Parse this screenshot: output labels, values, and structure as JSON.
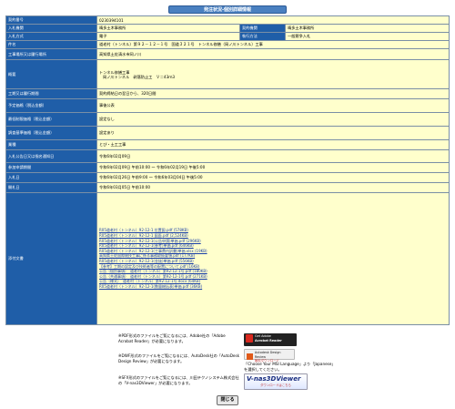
{
  "page_title": "発注状況-個別詳細情報",
  "rows": {
    "contract_no": {
      "label": "契約番号",
      "value": "0230394101"
    },
    "bureau": {
      "label": "入札機関",
      "value": "晴多土木事務所"
    },
    "contract_bureau": {
      "label": "契約機関",
      "value": "晴多土木事務所"
    },
    "bid_type": {
      "label": "入札方式",
      "value": "電子"
    },
    "exec_method": {
      "label": "執行方法",
      "value": "一般競争入札"
    },
    "work_name": {
      "label": "件名",
      "value": "道老村（トンネル）第９２－１２－１号　国道３２１号　トンネル修繕（岡ノ川トンネル）工事"
    },
    "location": {
      "label": "工事場所又は履行場所",
      "value": "高知県土佐清水市岡ノ川"
    },
    "summary": {
      "label": "概要",
      "line1": "トンネル修繕工事",
      "line2": "岡ノ川トンネル　剥落防止工　Ｖ＝43ｍ3"
    },
    "period": {
      "label": "工期又は履行期間",
      "value": "契約締結日の翌日から、320日間"
    },
    "prior_notice": {
      "label": "予定価格（税込金額）",
      "value": "事後公表"
    },
    "min_price": {
      "label": "最低制限価格（税込金額）",
      "value": "設定なし"
    },
    "survey_price": {
      "label": "調査基準価格（税込金額）",
      "value": "設定あり"
    },
    "category": {
      "label": "業種",
      "value": "とび・土工工事"
    },
    "notice_date": {
      "label": "入札公告日又は指名通知日",
      "value": "令和6年02月09日"
    },
    "apply_period": {
      "label": "参加申請期間",
      "value": "令和6年02月09日 午前10:00 ～ 令和6年02月19日 午後5:00"
    },
    "bid_period": {
      "label": "入札日",
      "value": "令和6年02月26日 午前9:00 ～ 令和6年03月04日 午後5:00"
    },
    "open_date": {
      "label": "開札日",
      "value": "令和6年03月05日 午前10:00"
    },
    "attachments": {
      "label": "添付文書"
    }
  },
  "documents": [
    "R05道老村（トンネル）92-12-1 位置図.pdf (578KB)",
    "R05道老村（トンネル）92-12-1 図面.pdf (2,524KB)",
    "R05道老村（トンネル）92-12-1(公告申請)単価.pdf (296KB)",
    "R05道老村（トンネル）92-12-1(参考)単価.pdf (646KB)",
    "R05道老村（トンネル）92-12-1(工事費内訳書)単価.xlsx (19KB)",
    "高知県土佐国際競技工事に係る事務取扱要領.pdf (177KB)",
    "R05道老村（トンネル）92-12-1(金抜)単価.pdf (556KB)",
    "【参考】工期の設定及び技術者等の配置について.pdf (16KB)",
    "公告（個別事項）　道老村（トンネル）第92-12-1号.pdf (180KB)",
    "公告（共通事項）　道老村（トンネル）第92-12-1号.pdf (271KB)",
    "公告（様式）　道老村（トンネル）第92-12-1号.docx (64KB)",
    "R05道老村（トンネル）92-12-1(数量総括表)単価.pdf (36KB)"
  ],
  "notes": {
    "pdf": "※PDF形式のファイルをご覧になるには、Adobe社の「Adobe Acrobat Reader」が必要になります。",
    "dwf": "※DWF形式のファイルをご覧になるには、AutoDesk社の「AutoDesk Design Review」が必要になります。",
    "dwf_note": "「Choose Your MSI Language」より「Japanese」を選択してください。",
    "sfx": "※SFX形式のファイルをご覧になるには、川田テクノシステム株式会社の「V-nas3DViewer」が必要になります。"
  },
  "banners": {
    "adobe_line1": "Get Adobe",
    "adobe_line2": "Acrobat Reader",
    "autodesk_line1": "Autodesk Design Review",
    "autodesk_line2": "無料ダウンロード",
    "vnas_line1": "V-nas3DViewer",
    "vnas_line2": "ダウンロードはこちら"
  },
  "close_label": "閉じる",
  "colors": {
    "label_bg": "#1f5ea8",
    "value_bg": "#ffffcc",
    "title_bg": "#4a80c0"
  }
}
